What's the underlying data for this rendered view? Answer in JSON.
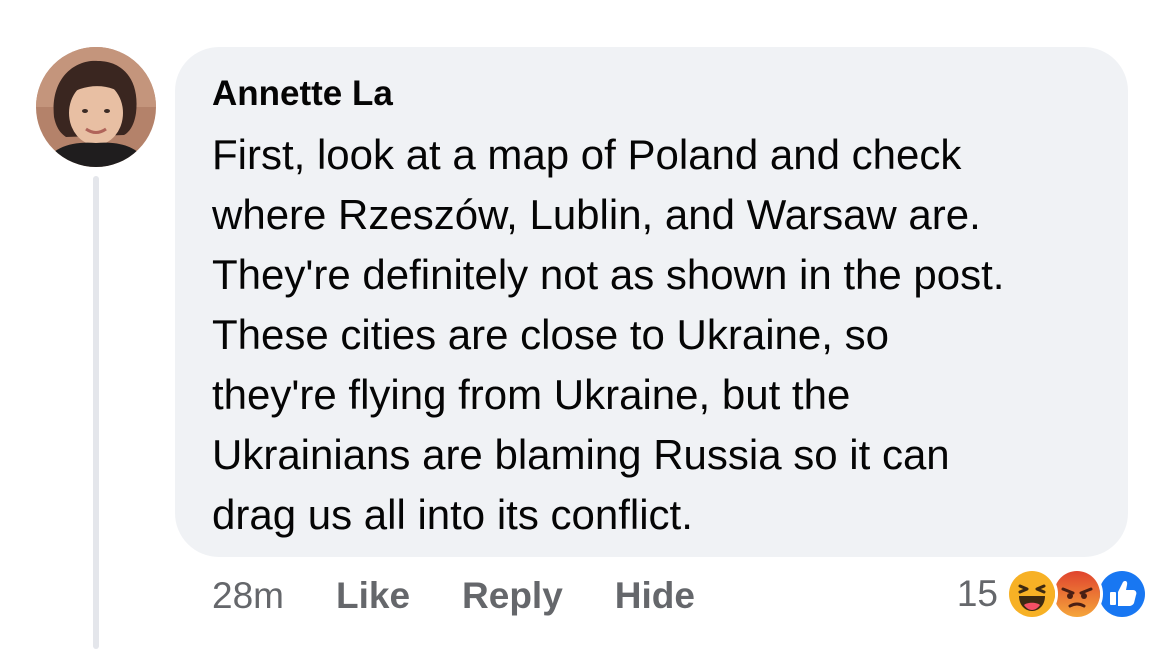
{
  "comment": {
    "author": "Annette La",
    "text": "First, look at a map of Poland and check\nwhere Rzeszów, Lublin, and Warsaw are.\nThey're definitely not as shown in the post.\nThese cities are close to Ukraine, so\nthey're flying from Ukraine, but the\nUkrainians are blaming Russia so it can\ndrag us all into its conflict."
  },
  "actions": {
    "time": "28m",
    "like": "Like",
    "reply": "Reply",
    "hide": "Hide"
  },
  "reactions": {
    "count": "15",
    "icons": [
      "haha-icon",
      "angry-icon",
      "like-icon"
    ]
  },
  "colors": {
    "bubble": "#f0f2f5",
    "meta_text": "#65676b",
    "like_blue": "#1877f2",
    "angry_red": "#e9710f",
    "haha_yellow": "#f7b125"
  }
}
